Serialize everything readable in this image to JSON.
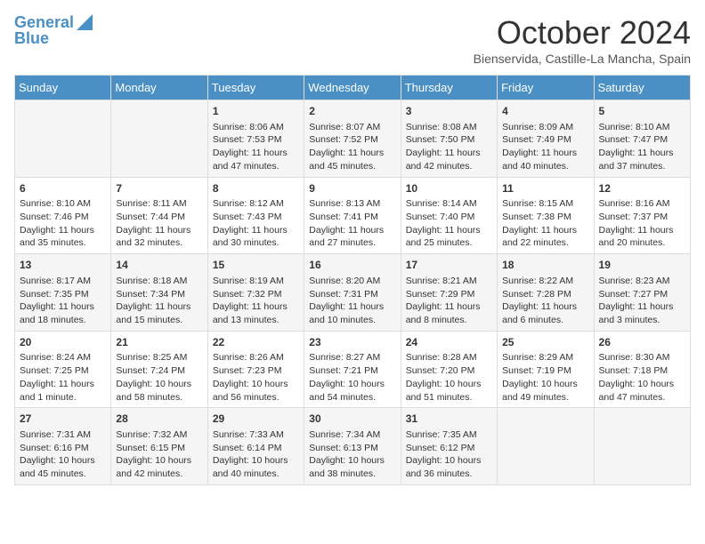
{
  "header": {
    "logo_line1": "General",
    "logo_line2": "Blue",
    "month_title": "October 2024",
    "subtitle": "Bienservida, Castille-La Mancha, Spain"
  },
  "days_of_week": [
    "Sunday",
    "Monday",
    "Tuesday",
    "Wednesday",
    "Thursday",
    "Friday",
    "Saturday"
  ],
  "weeks": [
    [
      {
        "day": "",
        "info": ""
      },
      {
        "day": "",
        "info": ""
      },
      {
        "day": "1",
        "info": "Sunrise: 8:06 AM\nSunset: 7:53 PM\nDaylight: 11 hours and 47 minutes."
      },
      {
        "day": "2",
        "info": "Sunrise: 8:07 AM\nSunset: 7:52 PM\nDaylight: 11 hours and 45 minutes."
      },
      {
        "day": "3",
        "info": "Sunrise: 8:08 AM\nSunset: 7:50 PM\nDaylight: 11 hours and 42 minutes."
      },
      {
        "day": "4",
        "info": "Sunrise: 8:09 AM\nSunset: 7:49 PM\nDaylight: 11 hours and 40 minutes."
      },
      {
        "day": "5",
        "info": "Sunrise: 8:10 AM\nSunset: 7:47 PM\nDaylight: 11 hours and 37 minutes."
      }
    ],
    [
      {
        "day": "6",
        "info": "Sunrise: 8:10 AM\nSunset: 7:46 PM\nDaylight: 11 hours and 35 minutes."
      },
      {
        "day": "7",
        "info": "Sunrise: 8:11 AM\nSunset: 7:44 PM\nDaylight: 11 hours and 32 minutes."
      },
      {
        "day": "8",
        "info": "Sunrise: 8:12 AM\nSunset: 7:43 PM\nDaylight: 11 hours and 30 minutes."
      },
      {
        "day": "9",
        "info": "Sunrise: 8:13 AM\nSunset: 7:41 PM\nDaylight: 11 hours and 27 minutes."
      },
      {
        "day": "10",
        "info": "Sunrise: 8:14 AM\nSunset: 7:40 PM\nDaylight: 11 hours and 25 minutes."
      },
      {
        "day": "11",
        "info": "Sunrise: 8:15 AM\nSunset: 7:38 PM\nDaylight: 11 hours and 22 minutes."
      },
      {
        "day": "12",
        "info": "Sunrise: 8:16 AM\nSunset: 7:37 PM\nDaylight: 11 hours and 20 minutes."
      }
    ],
    [
      {
        "day": "13",
        "info": "Sunrise: 8:17 AM\nSunset: 7:35 PM\nDaylight: 11 hours and 18 minutes."
      },
      {
        "day": "14",
        "info": "Sunrise: 8:18 AM\nSunset: 7:34 PM\nDaylight: 11 hours and 15 minutes."
      },
      {
        "day": "15",
        "info": "Sunrise: 8:19 AM\nSunset: 7:32 PM\nDaylight: 11 hours and 13 minutes."
      },
      {
        "day": "16",
        "info": "Sunrise: 8:20 AM\nSunset: 7:31 PM\nDaylight: 11 hours and 10 minutes."
      },
      {
        "day": "17",
        "info": "Sunrise: 8:21 AM\nSunset: 7:29 PM\nDaylight: 11 hours and 8 minutes."
      },
      {
        "day": "18",
        "info": "Sunrise: 8:22 AM\nSunset: 7:28 PM\nDaylight: 11 hours and 6 minutes."
      },
      {
        "day": "19",
        "info": "Sunrise: 8:23 AM\nSunset: 7:27 PM\nDaylight: 11 hours and 3 minutes."
      }
    ],
    [
      {
        "day": "20",
        "info": "Sunrise: 8:24 AM\nSunset: 7:25 PM\nDaylight: 11 hours and 1 minute."
      },
      {
        "day": "21",
        "info": "Sunrise: 8:25 AM\nSunset: 7:24 PM\nDaylight: 10 hours and 58 minutes."
      },
      {
        "day": "22",
        "info": "Sunrise: 8:26 AM\nSunset: 7:23 PM\nDaylight: 10 hours and 56 minutes."
      },
      {
        "day": "23",
        "info": "Sunrise: 8:27 AM\nSunset: 7:21 PM\nDaylight: 10 hours and 54 minutes."
      },
      {
        "day": "24",
        "info": "Sunrise: 8:28 AM\nSunset: 7:20 PM\nDaylight: 10 hours and 51 minutes."
      },
      {
        "day": "25",
        "info": "Sunrise: 8:29 AM\nSunset: 7:19 PM\nDaylight: 10 hours and 49 minutes."
      },
      {
        "day": "26",
        "info": "Sunrise: 8:30 AM\nSunset: 7:18 PM\nDaylight: 10 hours and 47 minutes."
      }
    ],
    [
      {
        "day": "27",
        "info": "Sunrise: 7:31 AM\nSunset: 6:16 PM\nDaylight: 10 hours and 45 minutes."
      },
      {
        "day": "28",
        "info": "Sunrise: 7:32 AM\nSunset: 6:15 PM\nDaylight: 10 hours and 42 minutes."
      },
      {
        "day": "29",
        "info": "Sunrise: 7:33 AM\nSunset: 6:14 PM\nDaylight: 10 hours and 40 minutes."
      },
      {
        "day": "30",
        "info": "Sunrise: 7:34 AM\nSunset: 6:13 PM\nDaylight: 10 hours and 38 minutes."
      },
      {
        "day": "31",
        "info": "Sunrise: 7:35 AM\nSunset: 6:12 PM\nDaylight: 10 hours and 36 minutes."
      },
      {
        "day": "",
        "info": ""
      },
      {
        "day": "",
        "info": ""
      }
    ]
  ]
}
